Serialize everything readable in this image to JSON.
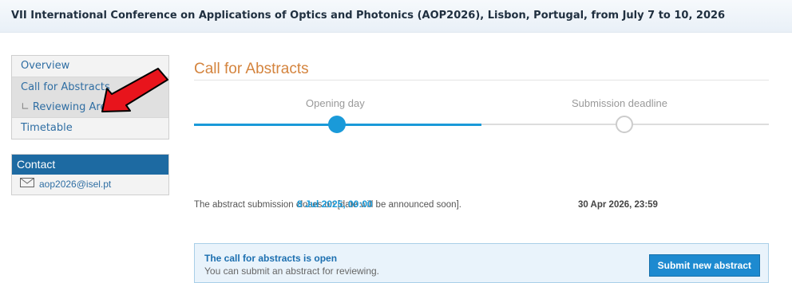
{
  "header": {
    "conference_title": "VII International Conference on Applications of Optics and Photonics (AOP2026), Lisbon, Portugal, from July 7 to 10, 2026"
  },
  "sidebar": {
    "items": [
      {
        "label": "Overview"
      },
      {
        "label": "Call for Abstracts"
      },
      {
        "label": "Reviewing Area",
        "corner": "∟"
      },
      {
        "label": "Timetable"
      }
    ]
  },
  "contact": {
    "heading": "Contact",
    "email": "aop2026@isel.pt"
  },
  "main": {
    "title": "Call for Abstracts",
    "timeline": {
      "step1_label": "Opening day",
      "step2_label": "Submission deadline",
      "progress_fraction": 0.5
    },
    "info_text": "The abstract submission closes on [date will be announced soon].",
    "opening_date": "8 Jul 2025, 00:00",
    "deadline_date": "30 Apr 2026, 23:59",
    "status": {
      "title": "The call for abstracts is open",
      "subtitle": "You can submit an abstract for reviewing.",
      "button_label": "Submit new abstract"
    }
  },
  "colors": {
    "accent": "#1a9ad9",
    "title": "#d4843e",
    "arrow": "#e8141c",
    "contact_bar": "#1d6aa2"
  }
}
